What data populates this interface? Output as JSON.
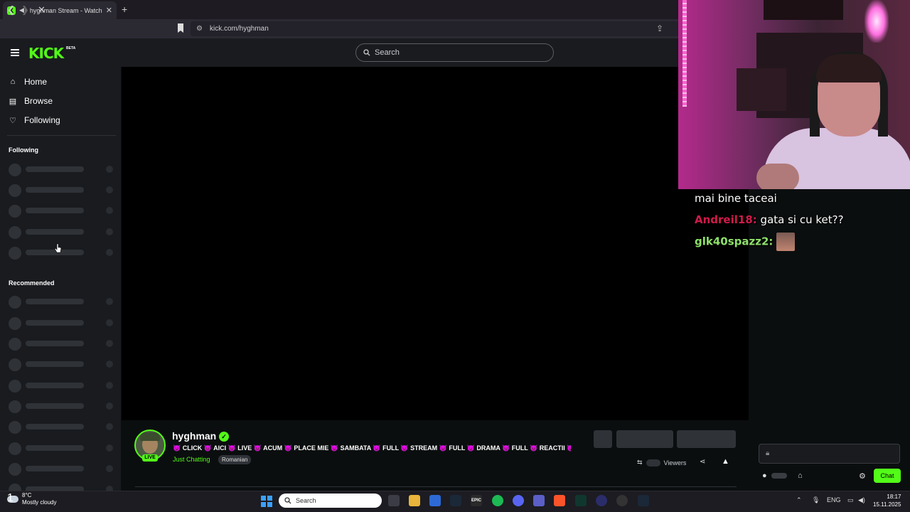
{
  "browser": {
    "tab_title": "hyghman Stream - Watch Liv",
    "tab_close": "✕",
    "new_tab": "+",
    "url": "kick.com/hyghman"
  },
  "kick_header": {
    "logo": "KICK",
    "beta": "BETA",
    "search_placeholder": "Search"
  },
  "sidebar": {
    "nav": [
      {
        "label": "Home",
        "icon": "home-icon"
      },
      {
        "label": "Browse",
        "icon": "browse-icon"
      },
      {
        "label": "Following",
        "icon": "heart-icon"
      }
    ],
    "following_title": "Following",
    "recommended_title": "Recommended"
  },
  "channel": {
    "name": "hyghman",
    "live_badge": "LIVE",
    "title": "👿 CLICK 👿 AICI 👿 LIVE 👿 ACUM 👿 PLACE MIE 👿 SAMBATA 👿 FULL 👿 STREAM 👿 FULL 👿 DRAMA 👿 FULL 👿 REACTII 👿 FUL...",
    "category": "Just Chatting",
    "language": "Romanian",
    "viewers_label": "Viewers"
  },
  "overlay_chat": [
    {
      "user": "",
      "message": "mai bine taceai",
      "user_color": "#ffffff"
    },
    {
      "user": "Andreil18:",
      "message": "gata si cu ket??",
      "user_color": "#d11a4a"
    },
    {
      "user": "glk40spazz2:",
      "message": "",
      "user_color": "#8ee06a"
    }
  ],
  "chat": {
    "button": "Chat"
  },
  "taskbar": {
    "weather_badge": "1",
    "temperature": "8°C",
    "weather": "Mostly cloudy",
    "search": "Search",
    "language": "ENG",
    "time": "18:17",
    "date": "15.11.2025"
  },
  "colors": {
    "kick_green": "#53fc18",
    "background": "#0b0e0f",
    "panel": "#191b1f"
  }
}
